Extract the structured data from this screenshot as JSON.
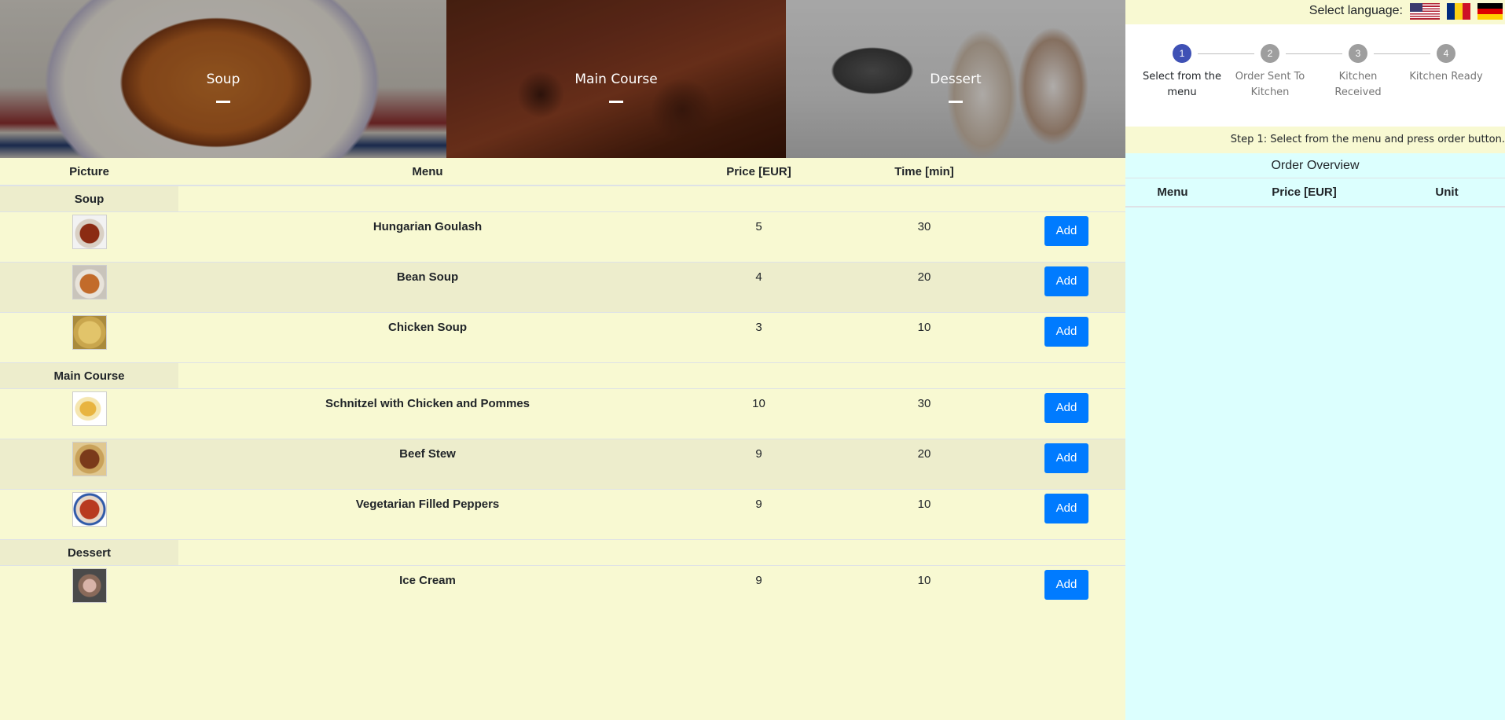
{
  "hero": {
    "soup_label": "Soup",
    "main_label": "Main Course",
    "dessert_label": "Dessert"
  },
  "menu_table": {
    "headers": {
      "picture": "Picture",
      "menu": "Menu",
      "price": "Price [EUR]",
      "time": "Time [min]"
    },
    "add_label": "Add",
    "categories": [
      {
        "name": "Soup",
        "items": [
          {
            "name": "Hungarian Goulash",
            "price": "5",
            "time": "30"
          },
          {
            "name": "Bean Soup",
            "price": "4",
            "time": "20"
          },
          {
            "name": "Chicken Soup",
            "price": "3",
            "time": "10"
          }
        ]
      },
      {
        "name": "Main Course",
        "items": [
          {
            "name": "Schnitzel with Chicken and Pommes",
            "price": "10",
            "time": "30"
          },
          {
            "name": "Beef Stew",
            "price": "9",
            "time": "20"
          },
          {
            "name": "Vegetarian Filled Peppers",
            "price": "9",
            "time": "10"
          }
        ]
      },
      {
        "name": "Dessert",
        "items": [
          {
            "name": "Ice Cream",
            "price": "9",
            "time": "10"
          }
        ]
      }
    ]
  },
  "language": {
    "label": "Select language:",
    "flags": [
      "us-flag-icon",
      "romania-flag-icon",
      "germany-flag-icon"
    ]
  },
  "stepper": {
    "steps": [
      {
        "number": "1",
        "label": "Select from the menu",
        "active": true
      },
      {
        "number": "2",
        "label": "Order Sent To Kitchen",
        "active": false
      },
      {
        "number": "3",
        "label": "Kitchen Received",
        "active": false
      },
      {
        "number": "4",
        "label": "Kitchen Ready",
        "active": false
      }
    ],
    "info": "Step 1: Select from the menu and press order button."
  },
  "overview": {
    "title": "Order Overview",
    "headers": {
      "menu": "Menu",
      "price": "Price [EUR]",
      "unit": "Unit"
    }
  },
  "colors": {
    "page_bg": "#f8f9d2",
    "panel_bg": "#dcfffe",
    "button": "#007bff",
    "active_step": "#3f51b5"
  }
}
